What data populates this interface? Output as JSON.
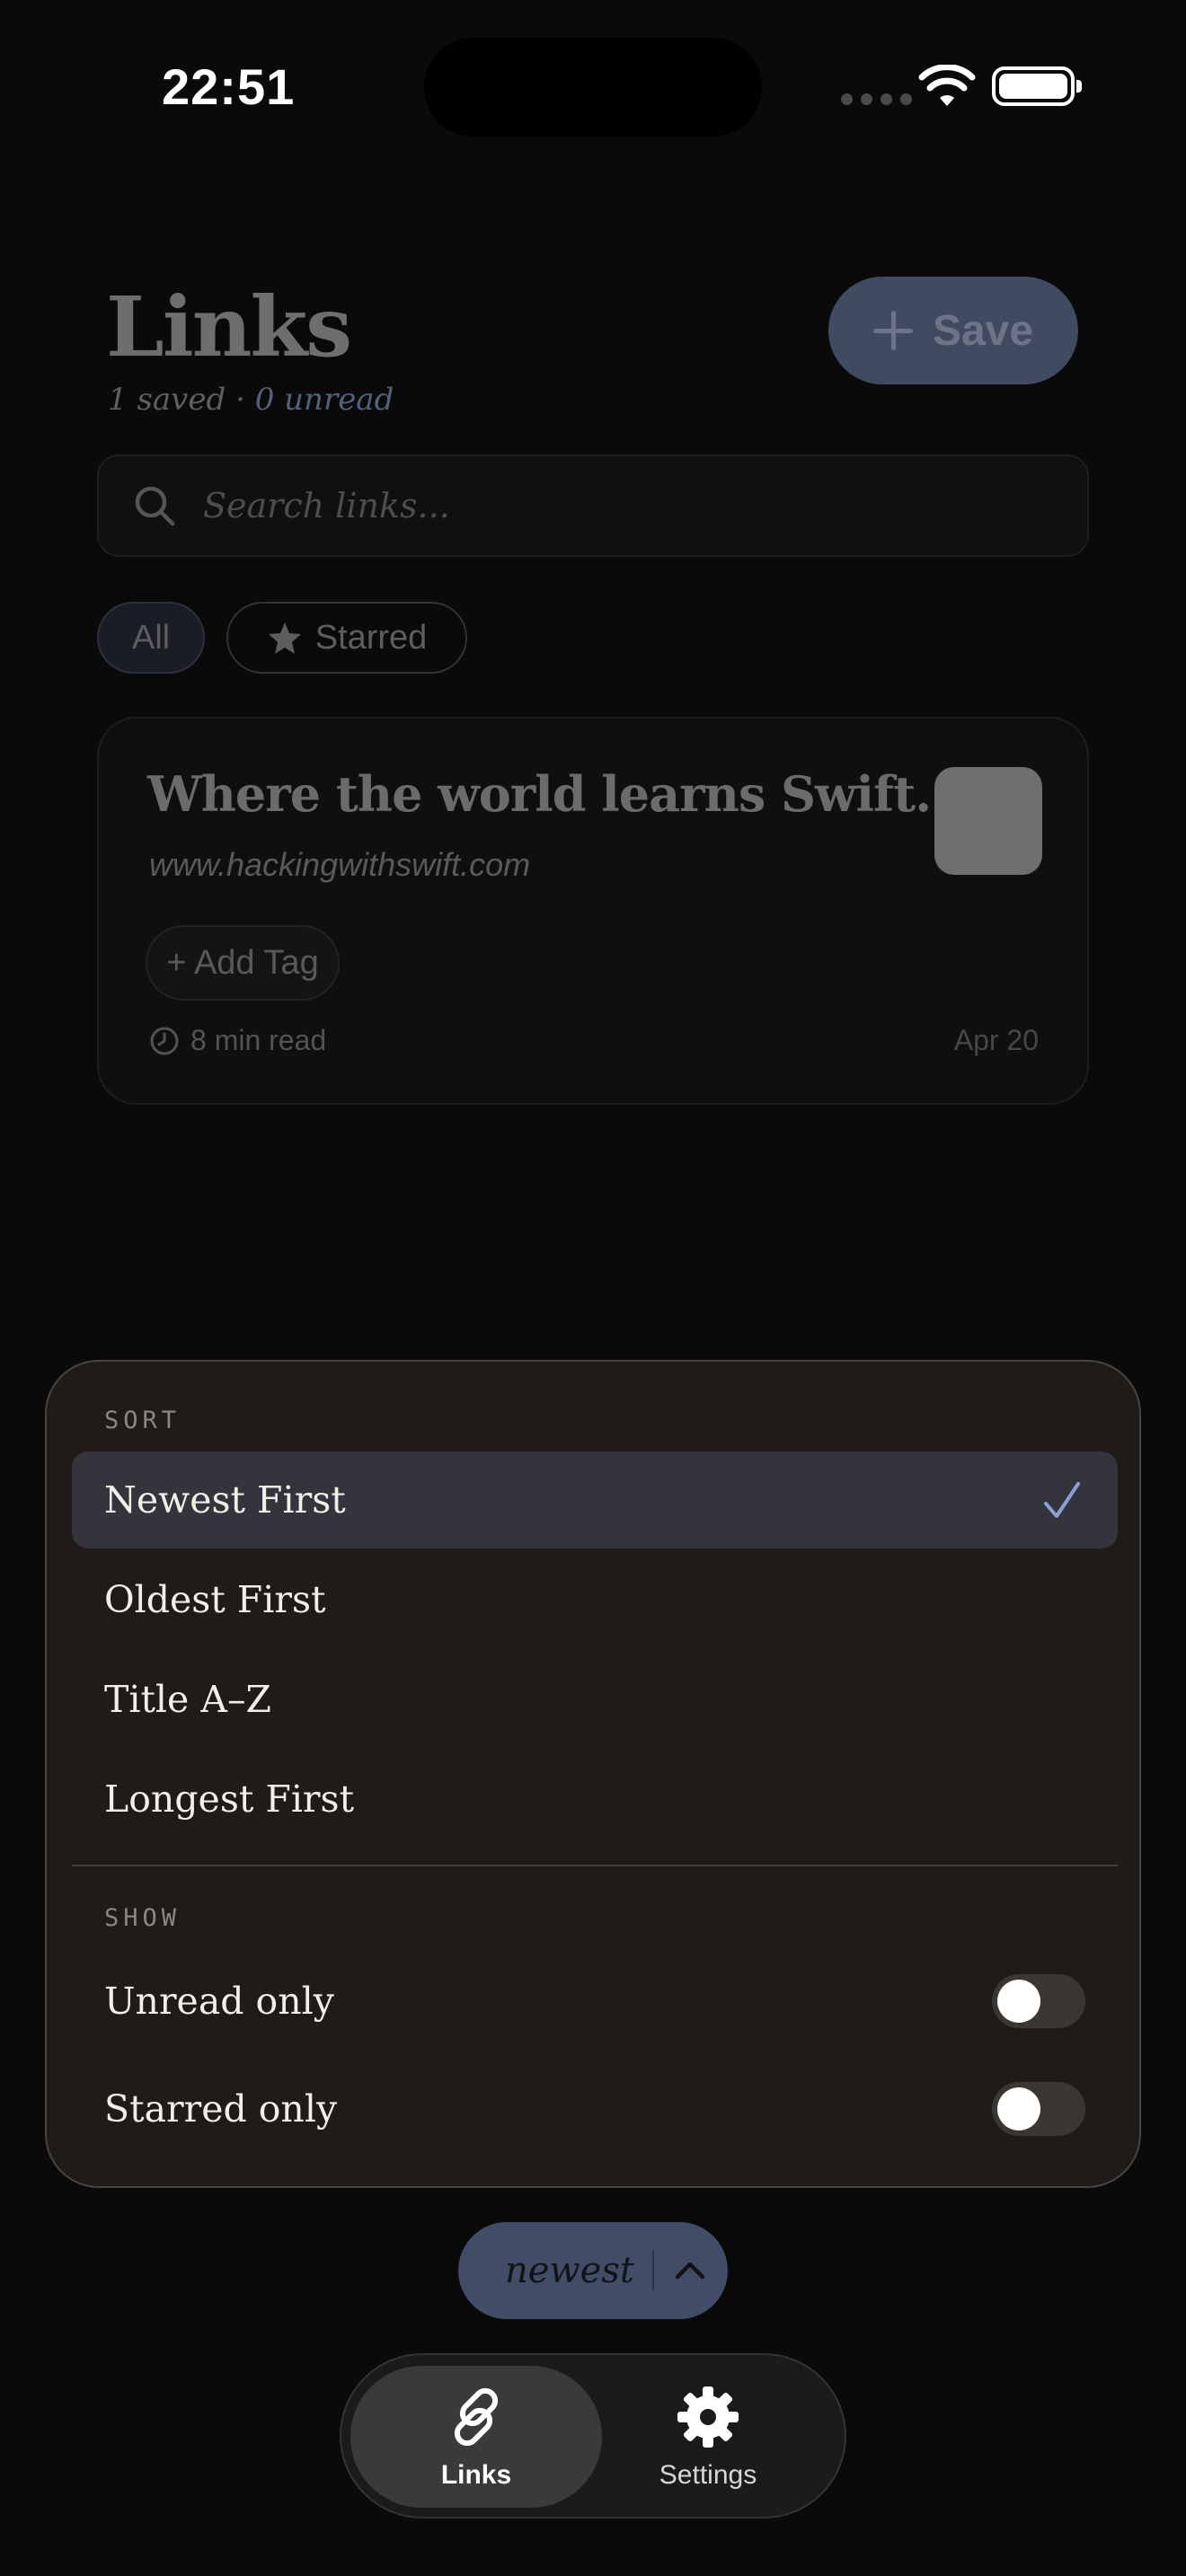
{
  "status": {
    "time": "22:51"
  },
  "header": {
    "title": "Links",
    "saved_count": "1 saved",
    "separator": " · ",
    "unread_count": "0 unread",
    "save_label": "Save"
  },
  "search": {
    "placeholder": "Search links..."
  },
  "filters": {
    "all": "All",
    "starred": "Starred"
  },
  "card": {
    "title": "Where the world learns Swift.",
    "url": "www.hackingwithswift.com",
    "add_tag": "+ Add Tag",
    "read_time": "8 min read",
    "date": "Apr 20"
  },
  "menu": {
    "sort_label": "SORT",
    "sort_options": [
      "Newest First",
      "Oldest First",
      "Title A–Z",
      "Longest First"
    ],
    "selected_sort": "Newest First",
    "show_label": "SHOW",
    "toggles": [
      {
        "label": "Unread only",
        "on": false
      },
      {
        "label": "Starred only",
        "on": false
      }
    ]
  },
  "sort_pill": {
    "label": "newest"
  },
  "tabs": [
    {
      "label": "Links",
      "icon": "link-icon",
      "active": true
    },
    {
      "label": "Settings",
      "icon": "gear-icon",
      "active": false
    }
  ],
  "colors": {
    "accent": "#8e9fd6",
    "background": "#0a0a0a",
    "menu_bg": "#1e1b19",
    "pill_bg": "#414c66"
  }
}
